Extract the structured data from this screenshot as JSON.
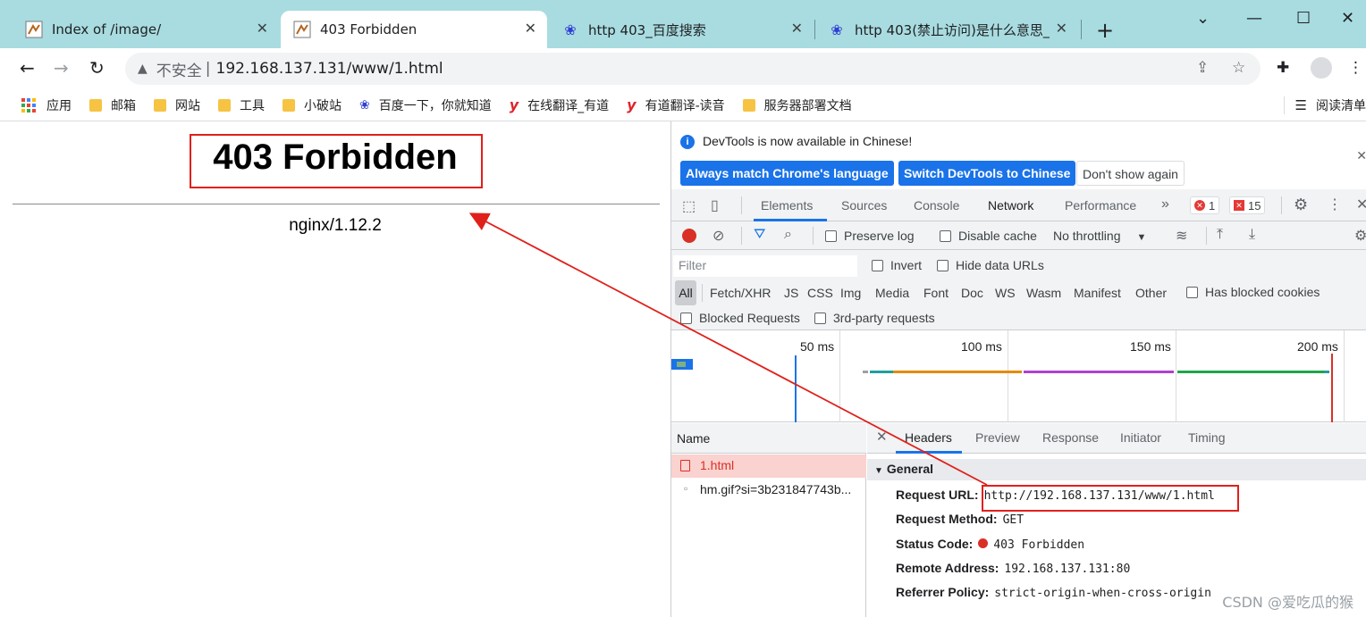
{
  "tabs": [
    {
      "title": "Index of /image/",
      "icon": "nginx-favicon-icon"
    },
    {
      "title": "403 Forbidden",
      "icon": "nginx-favicon-icon"
    },
    {
      "title": "http 403_百度搜索",
      "icon": "baidu-paw-icon"
    },
    {
      "title": "http 403(禁止访问)是什么意思_",
      "icon": "baidu-paw-icon"
    }
  ],
  "address_bar": {
    "security": "不安全",
    "separator": "|",
    "url": "192.168.137.131/www/1.html"
  },
  "bookmarks": [
    {
      "label": "应用",
      "icon": "apps-grid-icon"
    },
    {
      "label": "邮箱",
      "icon": "folder-icon"
    },
    {
      "label": "网站",
      "icon": "folder-icon"
    },
    {
      "label": "工具",
      "icon": "folder-icon"
    },
    {
      "label": "小破站",
      "icon": "folder-icon"
    },
    {
      "label": "百度一下，你就知道",
      "icon": "baidu-paw-icon"
    },
    {
      "label": "在线翻译_有道",
      "icon": "youdao-icon"
    },
    {
      "label": "有道翻译-读音",
      "icon": "youdao-icon"
    },
    {
      "label": "服务器部署文档",
      "icon": "folder-icon"
    }
  ],
  "reading_list": "阅读清单",
  "page": {
    "heading": "403 Forbidden",
    "server": "nginx/1.12.2"
  },
  "devtools": {
    "info_message": "DevTools is now available in Chinese!",
    "btn_match": "Always match Chrome's language",
    "btn_switch": "Switch DevTools to Chinese",
    "btn_dont_show": "Don't show again",
    "panels": [
      "Elements",
      "Sources",
      "Console",
      "Network",
      "Performance"
    ],
    "more_tabs": "»",
    "error_count": "1",
    "issue_count": "15",
    "preserve_log": "Preserve log",
    "disable_cache": "Disable cache",
    "throttling": "No throttling",
    "filter_placeholder": "Filter",
    "invert": "Invert",
    "hide_data_urls": "Hide data URLs",
    "filter_types": [
      "All",
      "Fetch/XHR",
      "JS",
      "CSS",
      "Img",
      "Media",
      "Font",
      "Doc",
      "WS",
      "Wasm",
      "Manifest",
      "Other"
    ],
    "has_blocked_cookies": "Has blocked cookies",
    "blocked_requests": "Blocked Requests",
    "third_party": "3rd-party requests",
    "timeline_labels": [
      "50 ms",
      "100 ms",
      "150 ms",
      "200 ms"
    ],
    "name_header": "Name",
    "requests": [
      "1.html",
      "hm.gif?si=3b231847743b..."
    ],
    "detail_tabs": [
      "Headers",
      "Preview",
      "Response",
      "Initiator",
      "Timing"
    ],
    "general_title": "General",
    "general": {
      "request_url_label": "Request URL:",
      "request_url": "http://192.168.137.131/www/1.html",
      "request_method_label": "Request Method:",
      "request_method": "GET",
      "status_code_label": "Status Code:",
      "status_code": "403 Forbidden",
      "remote_address_label": "Remote Address:",
      "remote_address": "192.168.137.131:80",
      "referrer_policy_label": "Referrer Policy:",
      "referrer_policy": "strict-origin-when-cross-origin"
    }
  },
  "watermark": "CSDN @爱吃瓜的猴",
  "colors": {
    "tabstrip": "#a8dce0",
    "annotation_red": "#e0201b",
    "devtools_blue": "#1a73e8",
    "error_red": "#d93025"
  }
}
